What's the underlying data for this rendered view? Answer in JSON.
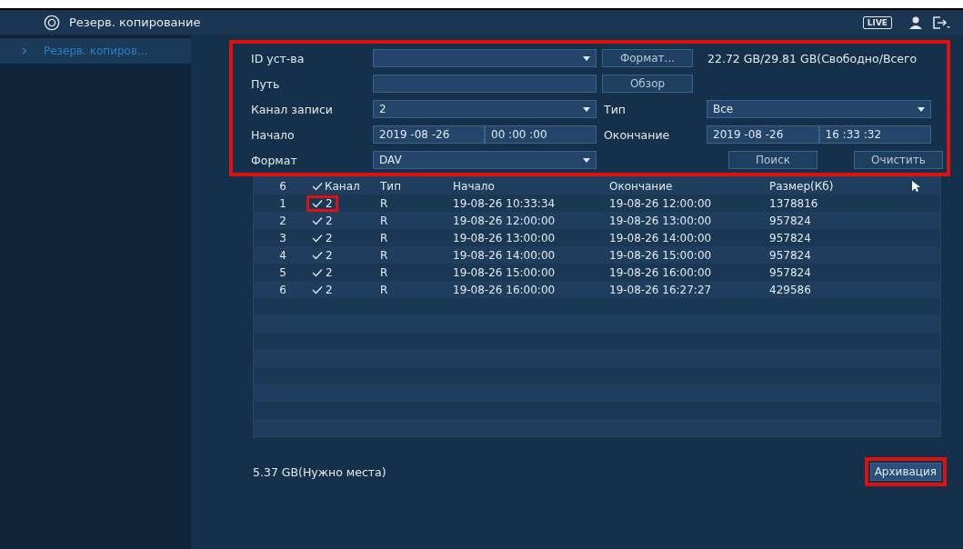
{
  "window": {
    "title": "Резерв. копирование"
  },
  "header": {
    "live_label": "LIVE"
  },
  "sidebar": {
    "items": [
      {
        "label": "Резерв. копиров...",
        "selected": true
      }
    ]
  },
  "form": {
    "highlighted": true,
    "device_label": "ID уст-ва",
    "format_button": "Формат...",
    "storage_info": "22.72 GB/29.81 GB(Свободно/Всего",
    "path_label": "Путь",
    "browse_button": "Обзор",
    "channel_label": "Канал записи",
    "channel_value": "2",
    "type_label": "Тип",
    "type_value": "Все",
    "start_label": "Начало",
    "start_date": "2019 -08 -26",
    "start_time": "00 :00 :00",
    "end_label": "Окончание",
    "end_date": "2019 -08 -26",
    "end_time": "16 :33 :32",
    "format_label": "Формат",
    "format_value": "DAV",
    "search_button": "Поиск",
    "clear_button": "Очистить"
  },
  "table": {
    "count": "6",
    "all_checked": true,
    "columns": [
      "Канал",
      "Тип",
      "Начало",
      "Окончание",
      "Размер(Кб)"
    ],
    "rows": [
      {
        "index": "1",
        "checked": true,
        "highlighted": true,
        "channel": "2",
        "type": "R",
        "start": "19-08-26 10:33:34",
        "end": "19-08-26 12:00:00",
        "size": "1378816"
      },
      {
        "index": "2",
        "checked": true,
        "channel": "2",
        "type": "R",
        "start": "19-08-26 12:00:00",
        "end": "19-08-26 13:00:00",
        "size": "957824"
      },
      {
        "index": "3",
        "checked": true,
        "channel": "2",
        "type": "R",
        "start": "19-08-26 13:00:00",
        "end": "19-08-26 14:00:00",
        "size": "957824"
      },
      {
        "index": "4",
        "checked": true,
        "channel": "2",
        "type": "R",
        "start": "19-08-26 14:00:00",
        "end": "19-08-26 15:00:00",
        "size": "957824"
      },
      {
        "index": "5",
        "checked": true,
        "channel": "2",
        "type": "R",
        "start": "19-08-26 15:00:00",
        "end": "19-08-26 16:00:00",
        "size": "957824"
      },
      {
        "index": "6",
        "checked": true,
        "channel": "2",
        "type": "R",
        "start": "19-08-26 16:00:00",
        "end": "19-08-26 16:27:27",
        "size": "429586"
      }
    ]
  },
  "footer": {
    "required_space": "5.37 GB(Нужно места)",
    "archive_button": "Архивация",
    "archive_highlighted": true
  }
}
